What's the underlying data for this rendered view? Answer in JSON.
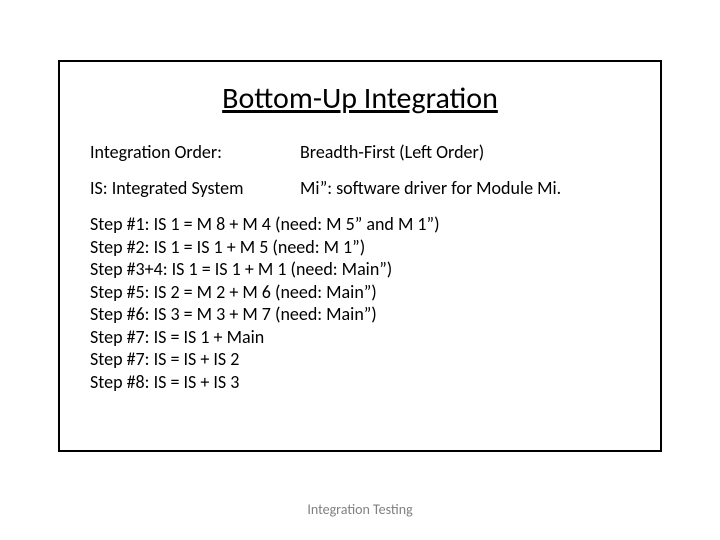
{
  "title": "Bottom-Up Integration",
  "row1": {
    "left": "Integration Order:",
    "right": "Breadth-First (Left Order)"
  },
  "row2": {
    "left": "IS: Integrated System",
    "right": "Mi”: software driver for Module Mi."
  },
  "steps": [
    "Step #1: IS 1 = M 8 + M 4 (need:  M 5” and M 1”)",
    "Step #2: IS 1 = IS 1 + M 5 (need:  M 1”)",
    "Step #3+4:  IS 1 = IS 1 + M 1 (need: Main”)",
    "Step #5: IS 2 = M 2 + M 6 (need: Main”)",
    "Step #6: IS 3 = M 3 + M 7 (need: Main”)",
    "Step #7: IS = IS 1 + Main",
    "Step #7: IS = IS + IS 2",
    "Step #8: IS = IS + IS 3"
  ],
  "footer": "Integration Testing"
}
